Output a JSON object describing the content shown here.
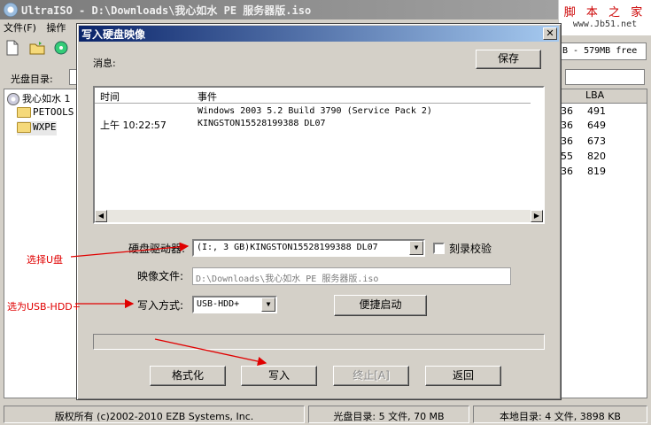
{
  "main_window": {
    "title": "UltraISO - D:\\Downloads\\我心如水 PE 服务器版.iso",
    "menu": [
      "文件(F)",
      "操作"
    ],
    "size_info": "B - 579MB free",
    "disc_dir_label": "光盘目录:"
  },
  "watermark": {
    "top": "脚 本 之 家",
    "url": "www.Jb51.net"
  },
  "tree": {
    "root": "我心如水 1",
    "children": [
      "PETOOLS",
      "WXPE"
    ]
  },
  "file_list": {
    "header": "LBA",
    "rows": [
      {
        "a": "36",
        "lba": "491"
      },
      {
        "a": "36",
        "lba": "649"
      },
      {
        "a": "36",
        "lba": "673"
      },
      {
        "a": "55",
        "lba": "820"
      },
      {
        "a": "36",
        "lba": "819"
      }
    ]
  },
  "statusbar": {
    "copyright": "版权所有 (c)2002-2010 EZB Systems, Inc.",
    "disc": "光盘目录: 5 文件, 70 MB",
    "local": "本地目录: 4 文件, 3898 KB"
  },
  "dialog": {
    "title": "写入硬盘映像",
    "close_glyph": "✕",
    "messages_label": "消息:",
    "save_label": "保存",
    "log": {
      "col_time": "时间",
      "col_event": "事件",
      "line1_event": "Windows 2003 5.2 Build 3790 (Service Pack 2)",
      "line2_time": "上午 10:22:57",
      "line2_event": "KINGSTON15528199388    DL07"
    },
    "drive_label": "硬盘驱动器:",
    "drive_value": "(I:, 3 GB)KINGSTON15528199388    DL07",
    "verify_label": "刻录校验",
    "verify_checked": false,
    "image_label": "映像文件:",
    "image_value": "D:\\Downloads\\我心如水 PE 服务器版.iso",
    "write_method_label": "写入方式:",
    "write_method_value": "USB-HDD+",
    "boot_button": "便捷启动",
    "progress": 0,
    "buttons": {
      "format": "格式化",
      "write": "写入",
      "abort": "终止[A]",
      "back": "返回"
    }
  },
  "annotations": {
    "select_usb": "选择U盘",
    "select_hdd": "选为USB-HDD+"
  },
  "colors": {
    "annotation": "#e00000",
    "dialog_title": "#0a246a"
  }
}
